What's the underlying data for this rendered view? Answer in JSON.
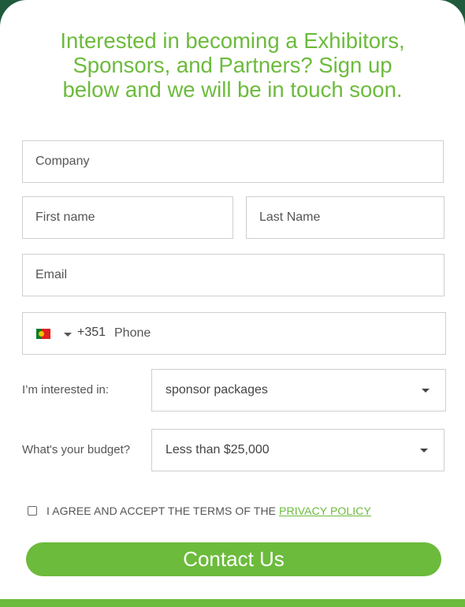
{
  "heading": {
    "line1": "Interested in becoming a Exhibitors,",
    "line2": "Sponsors, and Partners? Sign up",
    "line3": "below and we will be in touch soon."
  },
  "fields": {
    "company_placeholder": "Company",
    "first_name_placeholder": "First name",
    "last_name_placeholder": "Last Name",
    "email_placeholder": "Email",
    "phone_country_flag": "portugal-flag-icon",
    "phone_code": "+351",
    "phone_placeholder": "Phone"
  },
  "interest": {
    "label": "I’m interested in:",
    "value": "sponsor packages"
  },
  "budget": {
    "label": "What's your budget?",
    "value": "Less than $25,000"
  },
  "agreement": {
    "text": "I AGREE AND ACCEPT THE TERMS OF THE",
    "link": "PRIVACY POLICY"
  },
  "submit": {
    "label": "Contact Us"
  },
  "colors": {
    "accent": "#6cbb3c",
    "border": "#cfcfcf",
    "frame": "#1f5a3c"
  }
}
